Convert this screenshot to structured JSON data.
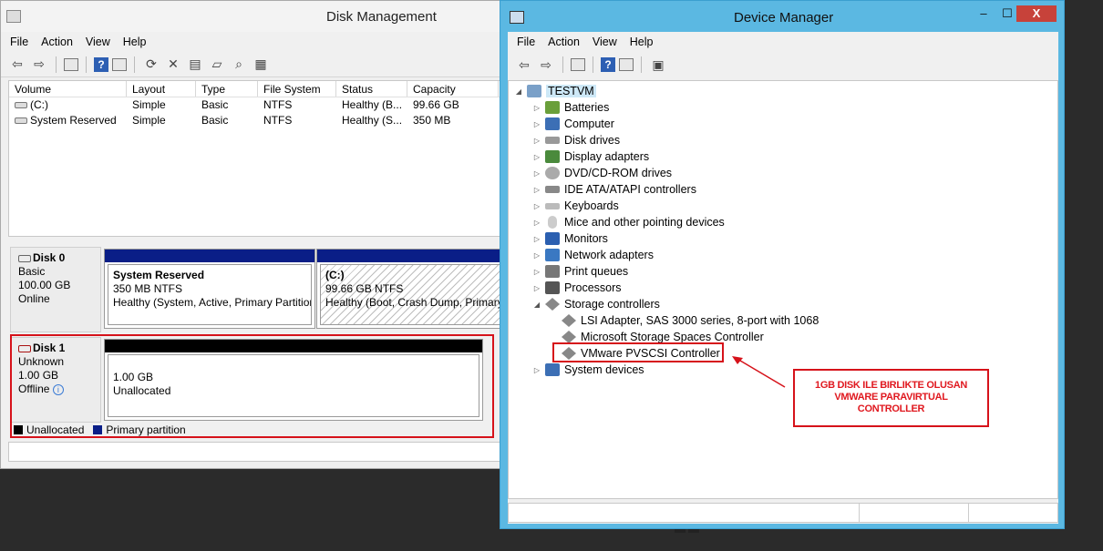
{
  "disk_management": {
    "title": "Disk Management",
    "menu": [
      "File",
      "Action",
      "View",
      "Help"
    ],
    "columns": [
      "Volume",
      "Layout",
      "Type",
      "File System",
      "Status",
      "Capacity"
    ],
    "volumes": [
      {
        "volume": "(C:)",
        "layout": "Simple",
        "type": "Basic",
        "fs": "NTFS",
        "status": "Healthy (B...",
        "capacity": "99.66 GB"
      },
      {
        "volume": "System Reserved",
        "layout": "Simple",
        "type": "Basic",
        "fs": "NTFS",
        "status": "Healthy (S...",
        "capacity": "350 MB"
      }
    ],
    "disk0": {
      "name": "Disk 0",
      "kind": "Basic",
      "size": "100.00 GB",
      "state": "Online"
    },
    "disk0_part1": {
      "name": "System Reserved",
      "size": "350 MB NTFS",
      "status": "Healthy (System, Active, Primary Partition)"
    },
    "disk0_part2": {
      "name": "(C:)",
      "size": "99.66 GB NTFS",
      "status": "Healthy (Boot, Crash Dump, Primary"
    },
    "disk1": {
      "name": "Disk 1",
      "kind": "Unknown",
      "size": "1.00 GB",
      "state": "Offline"
    },
    "disk1_part": {
      "size": "1.00 GB",
      "status": "Unallocated"
    },
    "legend": {
      "unallocated": "Unallocated",
      "primary": "Primary partition"
    }
  },
  "device_manager": {
    "title": "Device Manager",
    "window_buttons": {
      "minimize": "–",
      "maximize": "☐",
      "close": "X"
    },
    "menu": [
      "File",
      "Action",
      "View",
      "Help"
    ],
    "root": "TESTVM",
    "categories": [
      "Batteries",
      "Computer",
      "Disk drives",
      "Display adapters",
      "DVD/CD-ROM drives",
      "IDE ATA/ATAPI controllers",
      "Keyboards",
      "Mice and other pointing devices",
      "Monitors",
      "Network adapters",
      "Print queues",
      "Processors",
      "Storage controllers"
    ],
    "storage_children": [
      "LSI Adapter, SAS 3000 series, 8-port with 1068",
      "Microsoft Storage Spaces Controller",
      "VMware PVSCSI Controller"
    ],
    "last_category": "System devices"
  },
  "annotation": {
    "lines": [
      "1GB DISK ILE BIRLIKTE OLUSAN",
      "VMWARE PARAVIRTUAL",
      "CONTROLLER"
    ]
  },
  "colors": {
    "accent_red": "#d6121a",
    "primary_partition": "#0a1e87",
    "unallocated": "#000000",
    "devmgr_frame": "#5bb8e2"
  }
}
